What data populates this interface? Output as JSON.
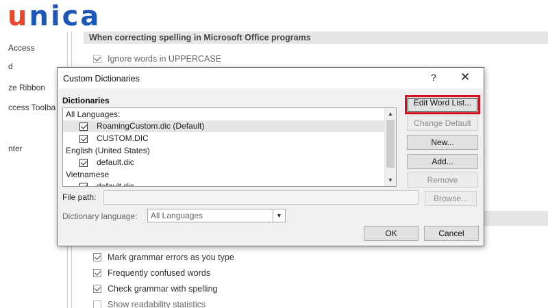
{
  "logo": {
    "u": "u",
    "rest": "nica"
  },
  "nav": [
    "Access",
    "d",
    "ze Ribbon",
    "ccess Toolba",
    "nter"
  ],
  "section_title": "When correcting spelling in Microsoft Office programs",
  "options_top": [
    {
      "label": "Ignore words in UPPERCASE",
      "checked": true
    }
  ],
  "options_bottom": [
    {
      "label": "Mark grammar errors as you type",
      "checked": true
    },
    {
      "label": "Frequently confused words",
      "checked": true
    },
    {
      "label": "Check grammar with spelling",
      "checked": true
    },
    {
      "label": "Show readability statistics",
      "checked": false
    }
  ],
  "dialog": {
    "title": "Custom Dictionaries",
    "help": "?",
    "close": "✕",
    "dictionaries_label": "Dictionaries",
    "list": [
      {
        "type": "header",
        "text": "All Languages:"
      },
      {
        "type": "item",
        "text": "RoamingCustom.dic (Default)",
        "checked": true,
        "selected": true
      },
      {
        "type": "item",
        "text": "CUSTOM.DIC",
        "checked": true,
        "selected": false
      },
      {
        "type": "header",
        "text": "English (United States)"
      },
      {
        "type": "item",
        "text": "default.dic",
        "checked": true,
        "selected": false
      },
      {
        "type": "header",
        "text": "Vietnamese"
      },
      {
        "type": "item",
        "text": "default.dic",
        "checked": true,
        "selected": false
      }
    ],
    "buttons": {
      "edit_word_list": "Edit Word List...",
      "change_default": "Change Default",
      "new": "New...",
      "add": "Add...",
      "remove": "Remove",
      "browse": "Browse...",
      "ok": "OK",
      "cancel": "Cancel"
    },
    "file_path_label": "File path:",
    "file_path_value": "",
    "language_label": "Dictionary language:",
    "language_value": "All Languages"
  },
  "colors": {
    "logo_u": "#e8492e",
    "logo_rest": "#1a57b6",
    "highlight": "#d4101f"
  }
}
